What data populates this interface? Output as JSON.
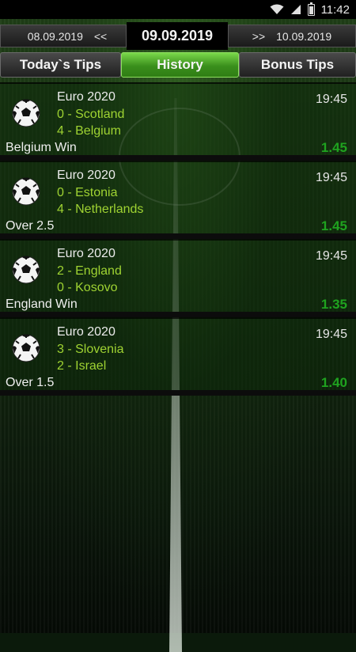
{
  "status_bar": {
    "time": "11:42",
    "icons": [
      "wifi-icon",
      "signal-icon",
      "battery-icon"
    ]
  },
  "date_nav": {
    "prev_date": "08.09.2019",
    "prev_arrow": "<<",
    "current_date": "09.09.2019",
    "next_arrow": ">>",
    "next_date": "10.09.2019"
  },
  "tabs": [
    {
      "label": "Today`s Tips",
      "active": false
    },
    {
      "label": "History",
      "active": true
    },
    {
      "label": "Bonus Tips",
      "active": false
    }
  ],
  "matches": [
    {
      "competition": "Euro 2020",
      "home": "0 - Scotland",
      "away": "4 - Belgium",
      "time": "19:45",
      "tip": "Belgium Win",
      "odds": "1.45"
    },
    {
      "competition": "Euro 2020",
      "home": "0 - Estonia",
      "away": "4 - Netherlands",
      "time": "19:45",
      "tip": "Over 2.5",
      "odds": "1.45"
    },
    {
      "competition": "Euro 2020",
      "home": "2 - England",
      "away": "0 - Kosovo",
      "time": "19:45",
      "tip": "England Win",
      "odds": "1.35"
    },
    {
      "competition": "Euro 2020",
      "home": "3 - Slovenia",
      "away": "2 - Israel",
      "time": "19:45",
      "tip": "Over 1.5",
      "odds": "1.40"
    }
  ],
  "colors": {
    "accent_green": "#9fd332",
    "odds_green": "#1fa31f",
    "active_tab": "#4caf2a"
  }
}
